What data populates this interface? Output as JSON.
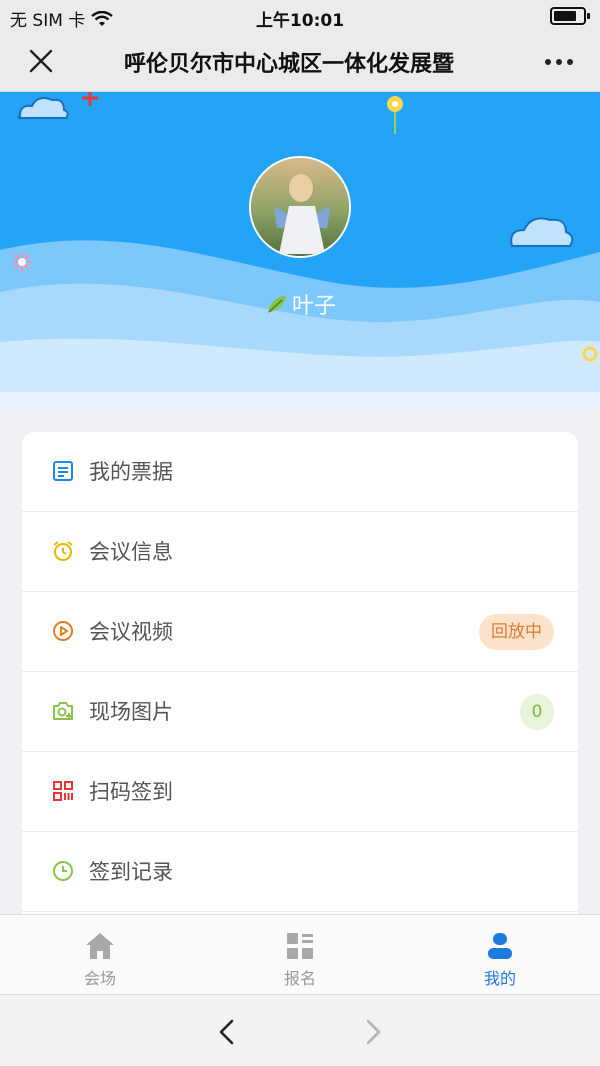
{
  "status_bar": {
    "carrier": "无 SIM 卡",
    "time": "上午10:01"
  },
  "nav": {
    "title": "呼伦贝尔市中心城区一体化发展暨"
  },
  "profile": {
    "username": "叶子"
  },
  "menu": [
    {
      "label": "我的票据",
      "icon": "ticket-icon",
      "color": "#1e88e5"
    },
    {
      "label": "会议信息",
      "icon": "alarm-clock-icon",
      "color": "#e6b800"
    },
    {
      "label": "会议视频",
      "icon": "play-circle-icon",
      "color": "#e67e22",
      "badge": "回放中"
    },
    {
      "label": "现场图片",
      "icon": "camera-icon",
      "color": "#8bc34a",
      "count": "0"
    },
    {
      "label": "扫码签到",
      "icon": "qrcode-icon",
      "color": "#e53935"
    },
    {
      "label": "签到记录",
      "icon": "clock-icon",
      "color": "#8bc34a"
    }
  ],
  "tabs": [
    {
      "label": "会场",
      "icon": "home-icon"
    },
    {
      "label": "报名",
      "icon": "grid-icon"
    },
    {
      "label": "我的",
      "icon": "user-icon",
      "active": true
    }
  ],
  "colors": {
    "header_blue": "#23a4f6",
    "active_tab": "#1f7ae0"
  }
}
